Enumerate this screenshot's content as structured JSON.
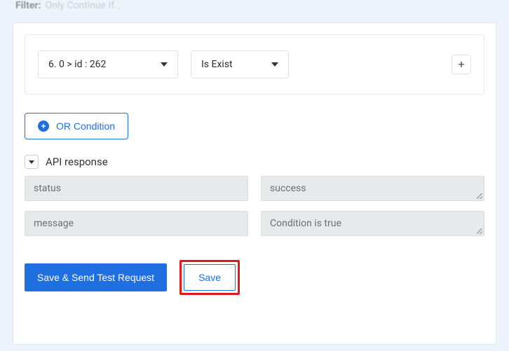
{
  "header": {
    "filter_label": "Filter:",
    "filter_value": "Only Continue If..."
  },
  "conditions": {
    "field_selected": "6. 0 > id : 262",
    "operator_selected": "Is Exist"
  },
  "or_button_label": "OR Condition",
  "api_response": {
    "title": "API response",
    "rows": [
      {
        "key": "status",
        "value": "success"
      },
      {
        "key": "message",
        "value": "Condition is true"
      }
    ]
  },
  "buttons": {
    "save_send": "Save & Send Test Request",
    "save": "Save"
  }
}
